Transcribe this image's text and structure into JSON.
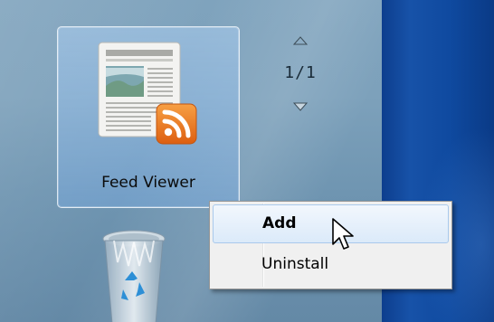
{
  "gadget_gallery": {
    "tile": {
      "label": "Feed Viewer"
    },
    "pager": {
      "page_indicator": "1/1"
    }
  },
  "context_menu": {
    "items": [
      {
        "label": "Add",
        "bold": true,
        "highlighted": true
      },
      {
        "label": "Uninstall",
        "bold": false,
        "highlighted": false
      }
    ]
  },
  "icons": {
    "feed_tile_icon": "feed-viewer-icon",
    "rss_badge": "rss-icon",
    "pager_up": "triangle-up-icon",
    "pager_down": "triangle-down-icon",
    "recycle_bin": "recycle-bin-icon",
    "cursor": "pointer-cursor-icon"
  },
  "colors": {
    "rss_orange": "#f07a1e",
    "tile_highlight": "#a6c8ee",
    "menu_highlight_border": "#a9c9ec",
    "desktop_blue": "#1752a8"
  }
}
